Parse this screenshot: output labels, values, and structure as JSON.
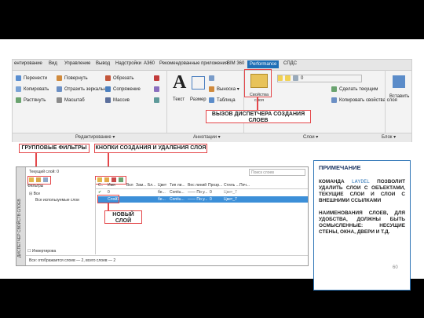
{
  "ribbon": {
    "tabs": [
      "ентирование",
      "Вид",
      "Управление",
      "Вывод",
      "Надстройки",
      "A360",
      "Рекомендованные приложения",
      "BIM 360",
      "Performance",
      "СПДС"
    ],
    "modify": {
      "items": [
        "Перенести",
        "Копировать",
        "Растянуть",
        "Повернуть",
        "Отразить зеркально",
        "Масштаб",
        "Обрезать",
        "Сопряжение",
        "Массив"
      ],
      "panel_label": "Редактирование ▾"
    },
    "annotation": {
      "text_label": "Текст",
      "size_label": "Размер",
      "leader_label": "Выноска ▾",
      "table_label": "Таблица",
      "panel_label": "Аннотации ▾"
    },
    "layers": {
      "props_label": "Свойства слоя",
      "make_current": "Сделать текущим",
      "match_props": "Копировать свойства слоя",
      "layer_value": "0",
      "panel_label": "Слои ▾"
    },
    "block": {
      "insert_label": "Вставить",
      "panel_label": "Блок ▾"
    }
  },
  "callouts": {
    "layer_manager": "ВЫЗОВ ДИСПЕТЧЕРА СОЗДАНИЯ СЛОЕВ",
    "group_filters": "ГРУППОВЫЕ ФИЛЬТРЫ",
    "create_delete": "КНОПКИ СОЗДАНИЯ И УДАЛЕНИЯ СЛОЯ",
    "new_layer": "НОВЫЙ СЛОЙ"
  },
  "dialog": {
    "current_layer": "Текущий слой: 0",
    "search_placeholder": "Поиск слоев",
    "side_title": "ДИСПЕТЧЕР СВОЙСТВ СЛОЕВ",
    "filters_header": "Фильтры",
    "tree_all": "Все",
    "tree_used": "Все используемые слои",
    "invert": "Инвертирова",
    "status": "Все: отображается слоев — 2, всего слоев — 2",
    "columns": [
      "С..",
      "Имя",
      "Вкл",
      "Зам...",
      "Бл...",
      "Цвет",
      "Тип ли...",
      "Вес линий",
      "Прозр...",
      "Стиль ...",
      "Печ..."
    ],
    "rows": [
      {
        "name": "0",
        "color": "бе...",
        "linetype": "Contiu...",
        "weight": "—— По у...",
        "transparency": "0",
        "style": "Цвет_7"
      },
      {
        "name": "Слой1",
        "color": "бе...",
        "linetype": "Contiu...",
        "weight": "—— По у...",
        "transparency": "0",
        "style": "Цвет_7"
      }
    ]
  },
  "note": {
    "title": "ПРИМЕЧАНИЕ",
    "p1_prefix": "КОМАНДА",
    "command": "LAYDEL",
    "p1_rest": "ПОЗВОЛИТ УДАЛИТЬ СЛОИ С ОБЪЕКТАМИ, ТЕКУЩИЕ СЛОИ И СЛОИ С ВНЕШНИМИ ССЫЛКАМИ",
    "p2": "НАИМЕНОВАНИЯ СЛОЕВ, ДЛЯ УДОБСТВА, ДОЛЖНЫ БЫТЬ ОСМЫСЛЕННЫЕ: НЕСУЩИЕ СТЕНЫ, ОКНА, ДВЕРИ И Т.Д."
  },
  "page_number": "60",
  "colors": {
    "callout_border": "#e4474a",
    "note_border": "#2e75b6",
    "selected_row": "#3c8fd8"
  }
}
